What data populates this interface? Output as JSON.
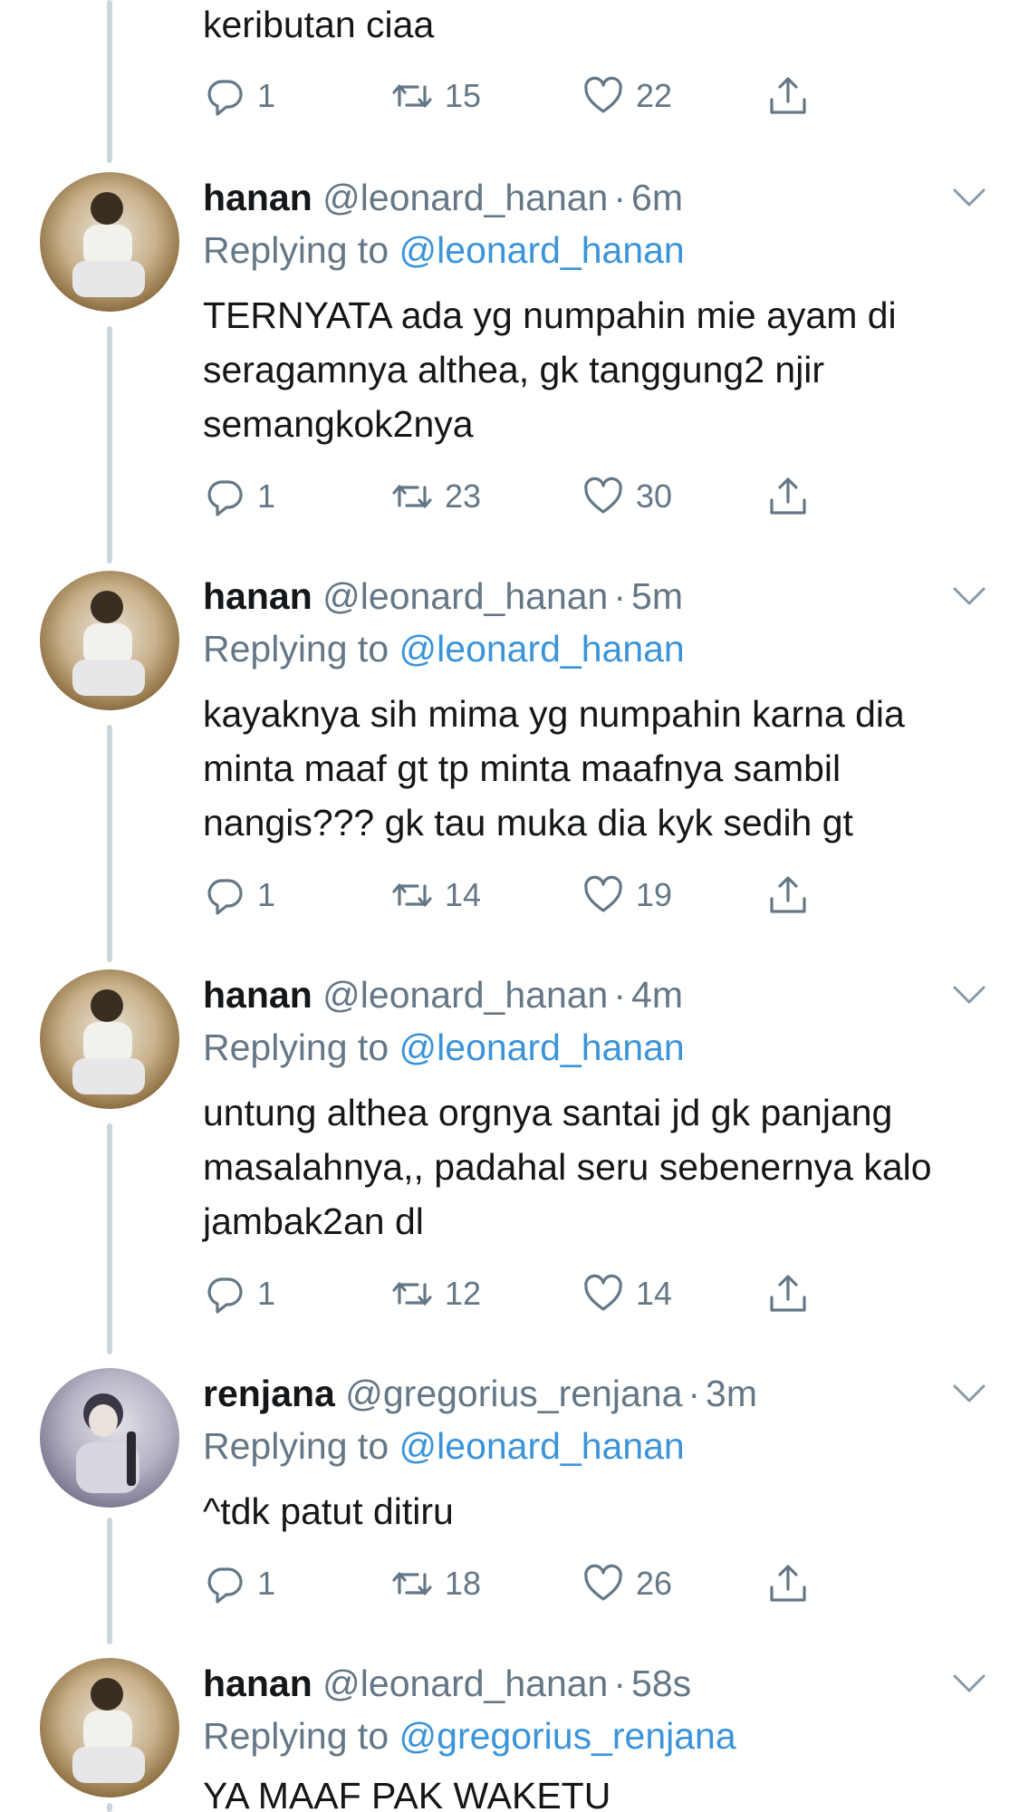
{
  "previous_tweet": {
    "text": "keributan ciaa",
    "stats": {
      "replies": "1",
      "retweets": "15",
      "likes": "22"
    }
  },
  "tweets": [
    {
      "name": "hanan",
      "handle": "@leonard_hanan",
      "separator": "·",
      "time": "6m",
      "replying_prefix": "Replying to",
      "replying_to": "@leonard_hanan",
      "text": "TERNYATA ada yg numpahin mie ayam di seragamnya althea, gk tanggung2 njir semangkok2nya",
      "stats": {
        "replies": "1",
        "retweets": "23",
        "likes": "30"
      }
    },
    {
      "name": "hanan",
      "handle": "@leonard_hanan",
      "separator": "·",
      "time": "5m",
      "replying_prefix": "Replying to",
      "replying_to": "@leonard_hanan",
      "text": "kayaknya sih mima yg numpahin karna dia minta maaf gt tp minta maafnya sambil nangis??? gk tau muka dia kyk sedih gt",
      "stats": {
        "replies": "1",
        "retweets": "14",
        "likes": "19"
      }
    },
    {
      "name": "hanan",
      "handle": "@leonard_hanan",
      "separator": "·",
      "time": "4m",
      "replying_prefix": "Replying to",
      "replying_to": "@leonard_hanan",
      "text": "untung althea orgnya santai jd gk panjang masalahnya,, padahal seru sebenernya kalo jambak2an dl",
      "stats": {
        "replies": "1",
        "retweets": "12",
        "likes": "14"
      }
    },
    {
      "name": "renjana",
      "handle": "@gregorius_renjana",
      "separator": "·",
      "time": "3m",
      "replying_prefix": "Replying to",
      "replying_to": "@leonard_hanan",
      "text": "^tdk patut ditiru",
      "stats": {
        "replies": "1",
        "retweets": "18",
        "likes": "26"
      }
    },
    {
      "name": "hanan",
      "handle": "@leonard_hanan",
      "separator": "·",
      "time": "58s",
      "replying_prefix": "Replying to",
      "replying_to": "@gregorius_renjana",
      "text": "YA MAAF PAK WAKETU"
    }
  ],
  "icons": {
    "reply": "reply-icon",
    "retweet": "retweet-icon",
    "like": "heart-icon",
    "share": "share-icon",
    "menu": "chevron-down-icon"
  },
  "colors": {
    "text": "#14171a",
    "secondary": "#657786",
    "link": "#3b94d9",
    "thread_line": "#ccd6dd"
  }
}
